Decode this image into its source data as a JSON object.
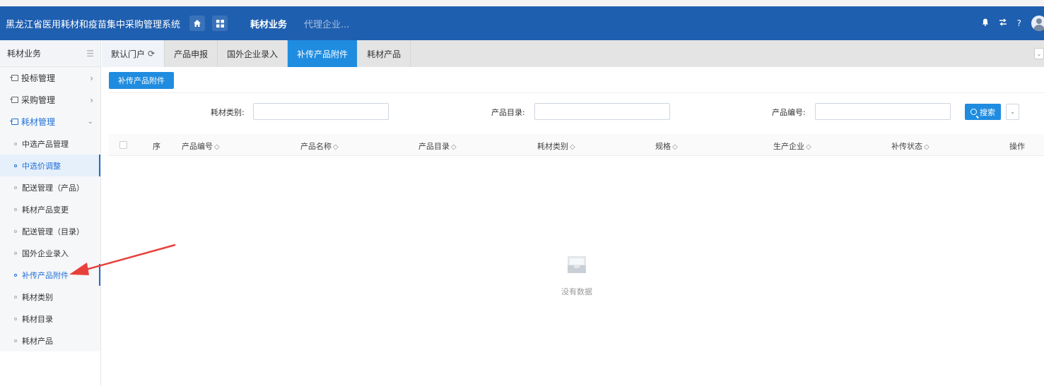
{
  "header": {
    "app_title": "黑龙江省医用耗材和疫苗集中采购管理系统",
    "nav_active": "耗材业务",
    "nav_dim": "代理企业...",
    "right_icons": [
      "bell-icon",
      "swap-icon",
      "help-icon",
      "avatar-icon"
    ],
    "help_label": "?"
  },
  "sidebar": {
    "title": "耗材业务",
    "groups": [
      {
        "label": "投标管理"
      },
      {
        "label": "采购管理"
      },
      {
        "label": "耗材管理"
      }
    ],
    "items": [
      {
        "label": "中选产品管理"
      },
      {
        "label": "中选价调整"
      },
      {
        "label": "配送管理（产品）"
      },
      {
        "label": "耗材产品变更"
      },
      {
        "label": "配送管理（目录）"
      },
      {
        "label": "国外企业录入"
      },
      {
        "label": "补传产品附件"
      },
      {
        "label": "耗材类别"
      },
      {
        "label": "耗材目录"
      },
      {
        "label": "耗材产品"
      }
    ]
  },
  "tabs": [
    {
      "label": "默认门户"
    },
    {
      "label": "产品申报"
    },
    {
      "label": "国外企业录入"
    },
    {
      "label": "补传产品附件"
    },
    {
      "label": "耗材产品"
    }
  ],
  "toolbar": {
    "upload_label": "补传产品附件"
  },
  "filters": {
    "category_label": "耗材类别:",
    "catalog_label": "产品目录:",
    "code_label": "产品编号:",
    "search_label": "搜索"
  },
  "table": {
    "columns": [
      "序",
      "产品编号",
      "产品名称",
      "产品目录",
      "耗材类别",
      "规格",
      "生产企业",
      "补传状态",
      "操作"
    ],
    "empty_text": "没有数据"
  },
  "colors": {
    "header_bg": "#1f5fb0",
    "accent": "#1f8ce0",
    "annotation_arrow": "#e8403a"
  }
}
